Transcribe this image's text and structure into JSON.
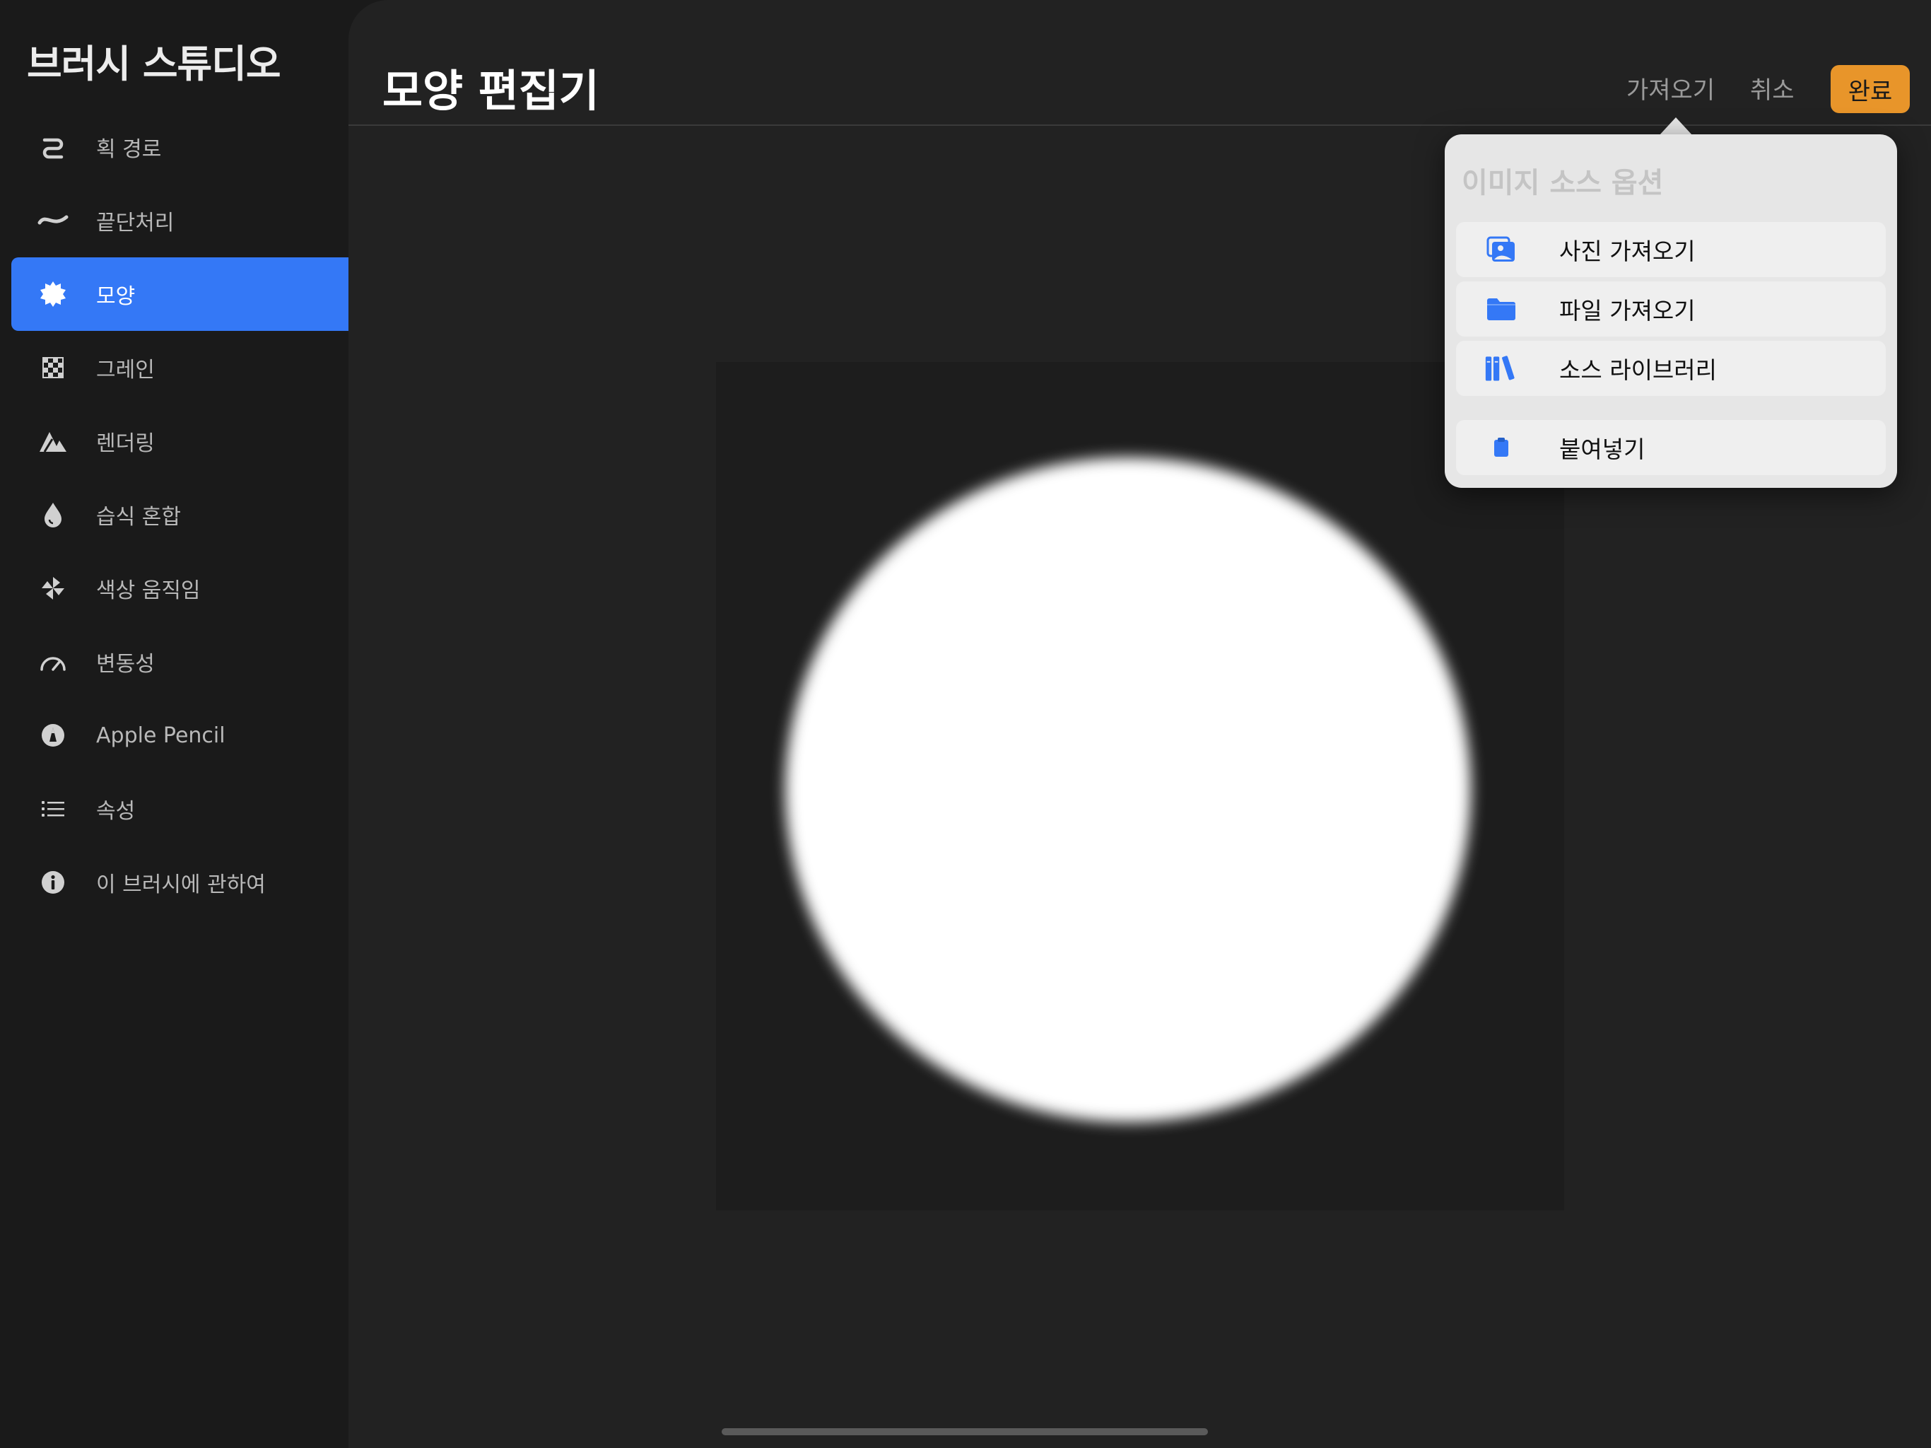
{
  "sidebar": {
    "title": "브러시 스튜디오",
    "items": [
      {
        "label": "획 경로",
        "icon": "stroke-path-icon"
      },
      {
        "label": "끝단처리",
        "icon": "taper-wave-icon"
      },
      {
        "label": "모양",
        "icon": "shape-gear-icon",
        "active": true
      },
      {
        "label": "그레인",
        "icon": "grain-checker-icon"
      },
      {
        "label": "렌더링",
        "icon": "rendering-mountain-icon"
      },
      {
        "label": "습식 혼합",
        "icon": "wet-mix-drop-icon"
      },
      {
        "label": "색상 움직임",
        "icon": "color-dynamics-pinwheel-icon"
      },
      {
        "label": "변동성",
        "icon": "dynamics-gauge-icon"
      },
      {
        "label": "Apple Pencil",
        "icon": "apple-pencil-icon"
      },
      {
        "label": "속성",
        "icon": "properties-list-icon"
      },
      {
        "label": "이 브러시에 관하여",
        "icon": "info-icon"
      }
    ]
  },
  "header": {
    "title": "모양 편집기",
    "import_label": "가져오기",
    "cancel_label": "취소",
    "done_label": "완료"
  },
  "popover": {
    "title": "이미지 소스 옵션",
    "items": [
      {
        "label": "사진 가져오기",
        "icon": "photo-import-icon"
      },
      {
        "label": "파일 가져오기",
        "icon": "folder-icon"
      },
      {
        "label": "소스 라이브러리",
        "icon": "library-books-icon"
      },
      {
        "label": "붙여넣기",
        "icon": "clipboard-paste-icon"
      }
    ]
  },
  "colors": {
    "accent_blue": "#3478f6",
    "done_orange": "#e8952a",
    "background": "#1a1a1a",
    "panel": "#222222"
  }
}
